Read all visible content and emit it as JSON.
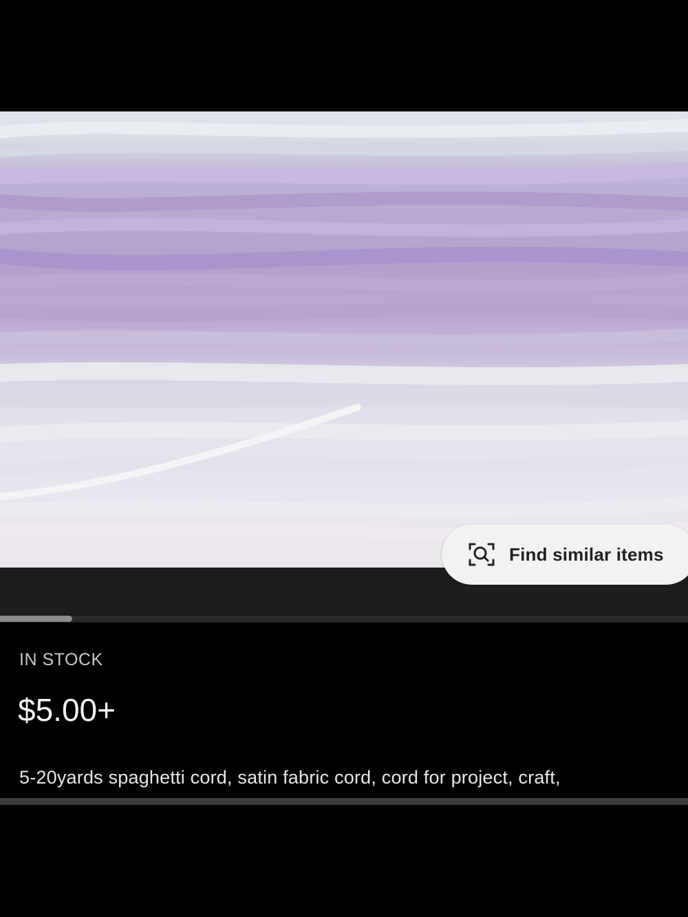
{
  "listing": {
    "find_similar_label": "Find similar items",
    "find_similar_icon": "visual-search-icon",
    "image_carousel_progress_percent": 10.5,
    "stock_status": "IN STOCK",
    "price": "$5.00+",
    "title": "5-20yards  spaghetti cord,  satin fabric cord,  cord for project,  craft,"
  }
}
